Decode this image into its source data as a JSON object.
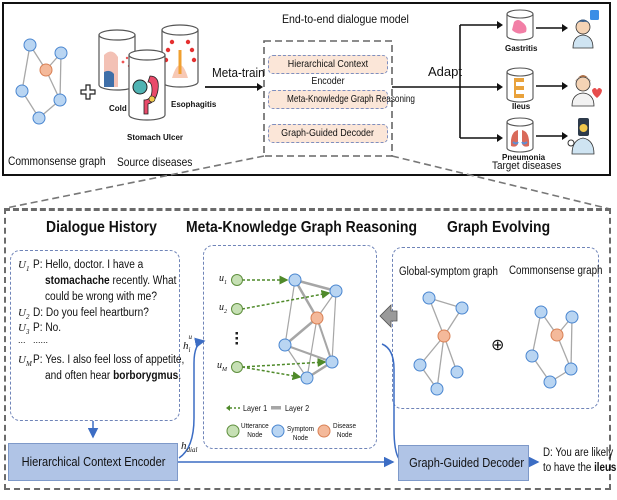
{
  "top": {
    "commonsense_label": "Commonsense graph",
    "source_diseases_label": "Source diseases",
    "source_diseases": [
      "Cold",
      "Stomach Ulcer",
      "Esophagitis"
    ],
    "meta_train_label": "Meta-train",
    "model_title": "End-to-end dialogue model",
    "modules": [
      "Hierarchical Context Encoder",
      "Meta-Knowledge Graph Reasoning",
      "Graph-Guided Decoder"
    ],
    "adapt_label": "Adapt",
    "target_diseases": [
      "Gastritis",
      "Ileus",
      "Pneumonia"
    ],
    "target_diseases_label": "Target diseases"
  },
  "bottom": {
    "dialogue_history_title": "Dialogue History",
    "mkgr_title": "Meta-Knowledge Graph Reasoning",
    "graph_evolving_title": "Graph Evolving",
    "dialogue": [
      {
        "id": "U",
        "sub": "1",
        "lines": [
          "P: Hello, doctor. I have a",
          "stomachache recently. What",
          "could be wrong with me?"
        ],
        "bold_word": "stomachache"
      },
      {
        "id": "U",
        "sub": "2",
        "lines": [
          "D: Do you feel heartburn?"
        ]
      },
      {
        "id": "U",
        "sub": "3",
        "lines": [
          "P: No."
        ]
      },
      {
        "id": "...",
        "sub": "",
        "lines": [
          "......"
        ]
      },
      {
        "id": "U",
        "sub": "M",
        "lines": [
          "P: Yes. I also feel loss of appetite,",
          "and often hear borborygmus."
        ],
        "bold_word": "borborygmus"
      }
    ],
    "utterance_nodes": [
      "u1",
      "u2",
      "uM"
    ],
    "utterance_labels": {
      "u1": "u",
      "u1_sub": "1",
      "u2": "u",
      "u2_sub": "2",
      "uM": "u",
      "uM_sub": "M"
    },
    "legend": {
      "layer1": "Layer 1",
      "layer2": "Layer 2",
      "utterance_node": [
        "Utterance",
        "Node"
      ],
      "symptom_node": [
        "Symptom",
        "Node"
      ],
      "disease_node": [
        "Disease",
        "Node"
      ]
    },
    "global_symptom_graph_label": "Global-symptom graph",
    "commonsense_graph_label": "Commonsense graph",
    "oplus_symbol": "⊕",
    "encoder_label": "Hierarchical Context Encoder",
    "decoder_label": "Graph-Guided Decoder",
    "h_u_label": "h",
    "h_u_sub": "i",
    "h_u_sup": "u",
    "h_dial_label": "h",
    "h_dial_sub": "dial",
    "output_lines": [
      "D: You are likely",
      "to have the ileus."
    ],
    "output_bold_word": "ileus"
  },
  "colors": {
    "symptom_node_fill": "#b9d5f2",
    "symptom_node_stroke": "#4a86d0",
    "disease_node_fill": "#f4b99a",
    "disease_node_stroke": "#d98155",
    "utterance_node_fill": "#c6e0b4",
    "utterance_node_stroke": "#5f8f3e",
    "layer1_color": "#4f8a2a",
    "layer2_color": "#a6a6a6",
    "module_fill": "#fbe6d8",
    "encoder_fill": "#b0c4e6",
    "flow_arrow": "#3c6dc4"
  }
}
